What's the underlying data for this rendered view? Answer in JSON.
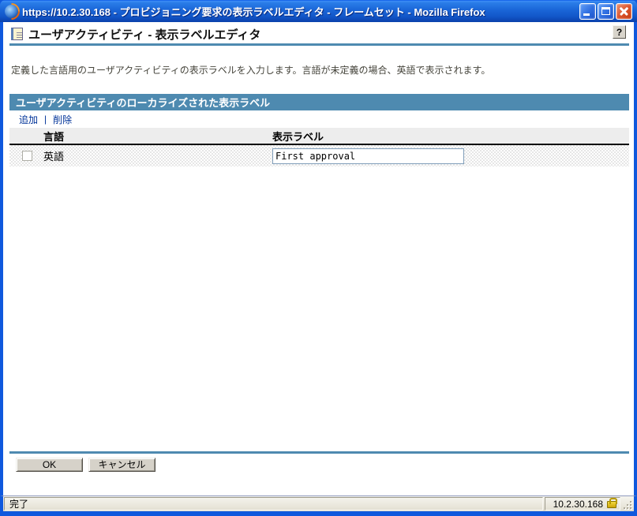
{
  "window": {
    "title": "https://10.2.30.168 - プロビジョニング要求の表示ラベルエディタ - フレームセット - Mozilla Firefox",
    "controls": {
      "minimize": "minimize-window",
      "maximize": "maximize-window",
      "close": "close-window"
    }
  },
  "page": {
    "title": "ユーザアクティビティ - 表示ラベルエディタ",
    "help_label": "?",
    "description": "定義した言語用のユーザアクティビティの表示ラベルを入力します。言語が未定義の場合、英語で表示されます。"
  },
  "panel": {
    "header": "ユーザアクティビティのローカライズされた表示ラベル",
    "actions": {
      "add": "追加",
      "separator": "|",
      "delete": "削除"
    },
    "columns": {
      "language": "言語",
      "display_label": "表示ラベル"
    },
    "rows": [
      {
        "language": "英語",
        "display_label": "First approval",
        "checked": false
      }
    ]
  },
  "footer": {
    "ok": "OK",
    "cancel": "キャンセル"
  },
  "statusbar": {
    "status": "完了",
    "host": "10.2.30.168",
    "lock_icon": "ssl-lock"
  },
  "colors": {
    "accent": "#4e8ab0",
    "link": "#003399",
    "titlebar_blue": "#1863d6",
    "frame_blue": "#0f58dd",
    "lock_gold": "#cfa608"
  }
}
